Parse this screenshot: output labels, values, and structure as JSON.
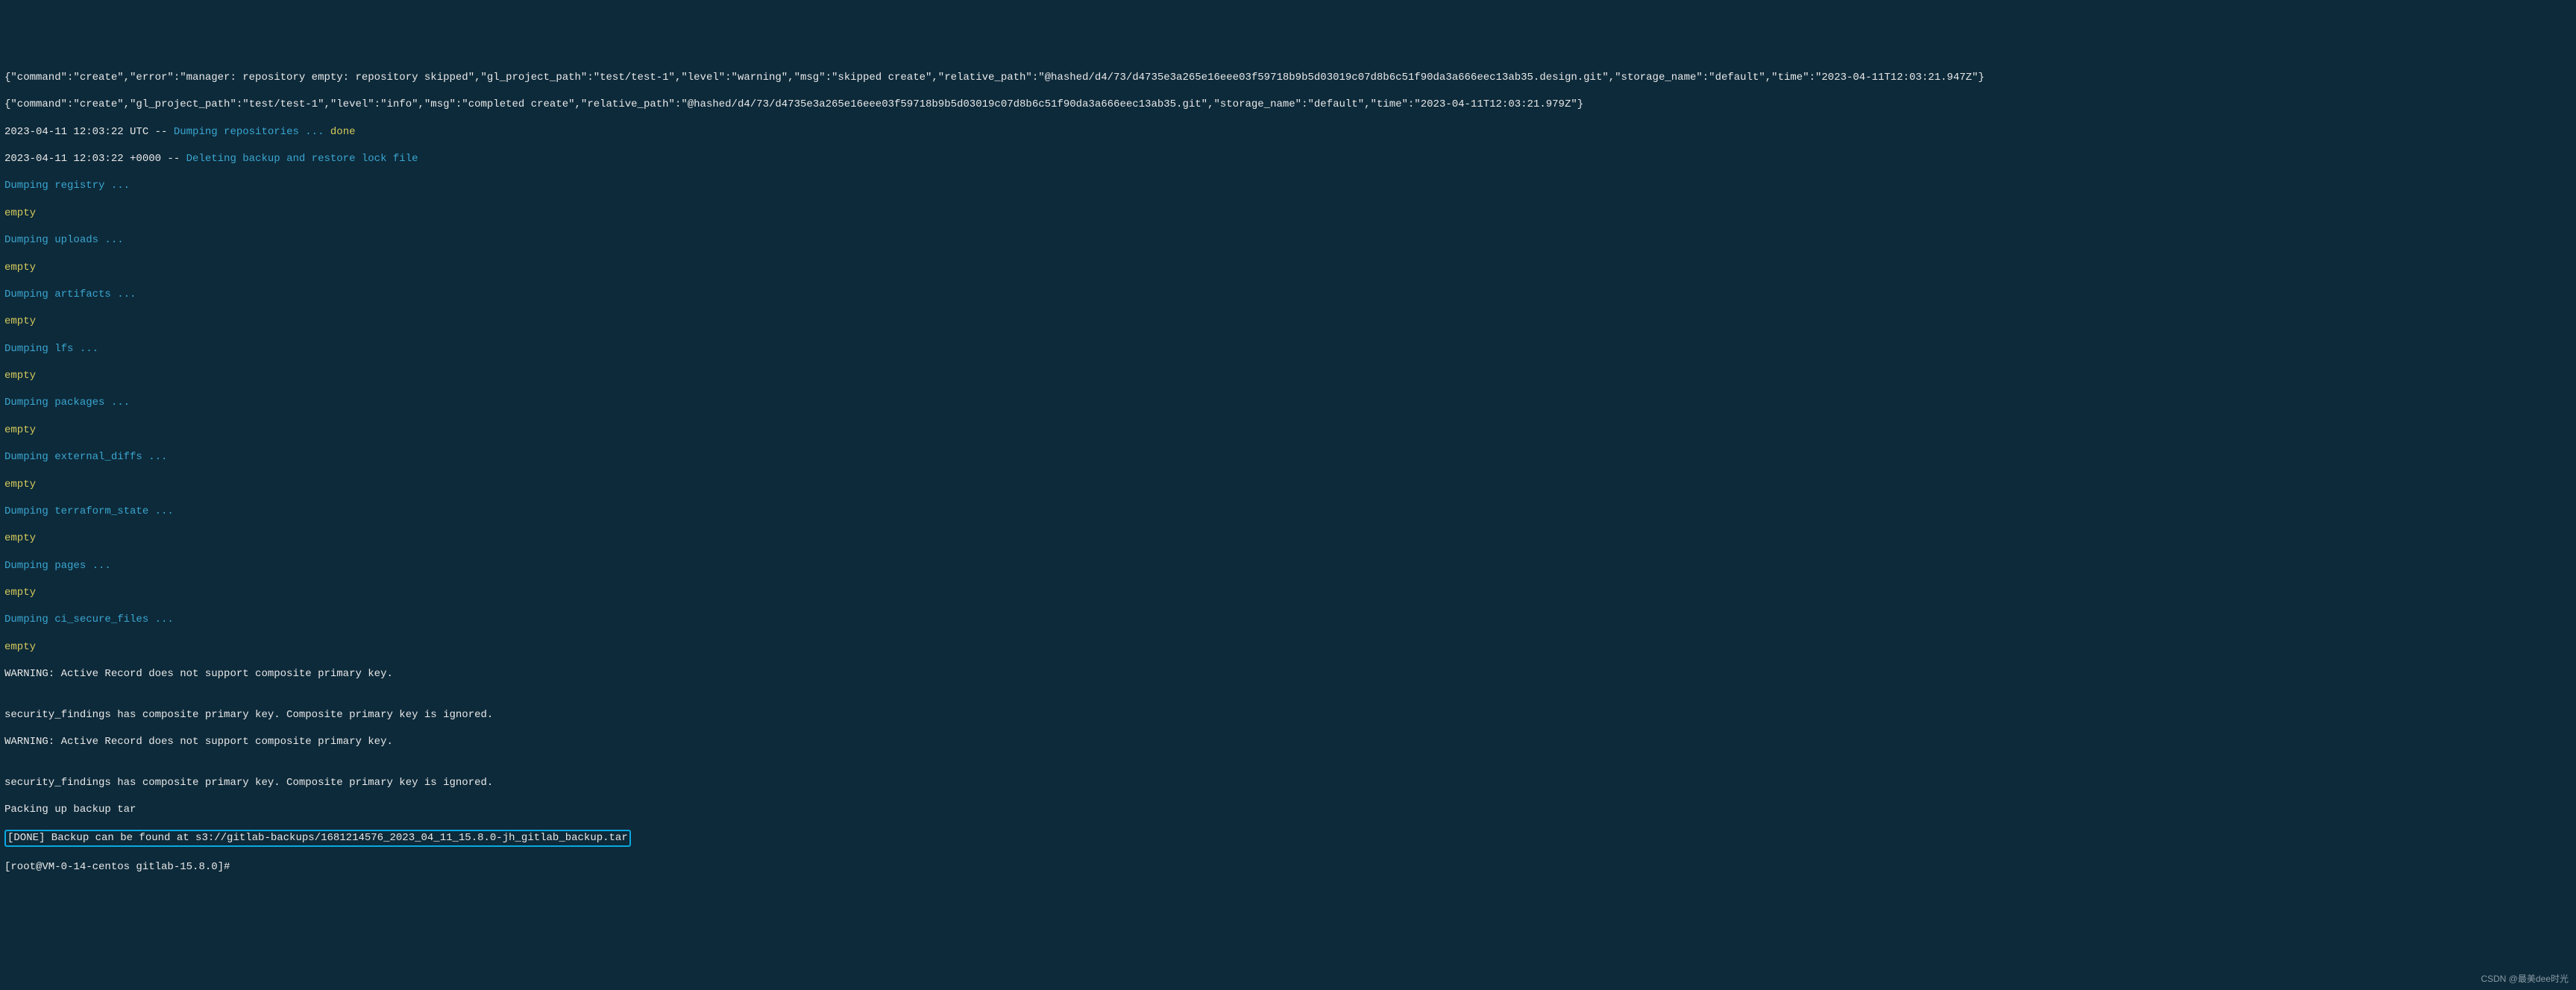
{
  "json_line1": "{\"command\":\"create\",\"error\":\"manager: repository empty: repository skipped\",\"gl_project_path\":\"test/test-1\",\"level\":\"warning\",\"msg\":\"skipped create\",\"relative_path\":\"@hashed/d4/73/d4735e3a265e16eee03f59718b9b5d03019c07d8b6c51f90da3a666eec13ab35.design.git\",\"storage_name\":\"default\",\"time\":\"2023-04-11T12:03:21.947Z\"}",
  "json_line2": "{\"command\":\"create\",\"gl_project_path\":\"test/test-1\",\"level\":\"info\",\"msg\":\"completed create\",\"relative_path\":\"@hashed/d4/73/d4735e3a265e16eee03f59718b9b5d03019c07d8b6c51f90da3a666eec13ab35.git\",\"storage_name\":\"default\",\"time\":\"2023-04-11T12:03:21.979Z\"}",
  "ts1_prefix": "2023-04-11 12:03:22 UTC -- ",
  "ts1_msg": "Dumping repositories ... ",
  "ts1_done": "done",
  "ts2_prefix": "2023-04-11 12:03:22 +0000 -- ",
  "ts2_msg": "Deleting backup and restore lock file",
  "dump_registry": "Dumping registry ...",
  "dump_uploads": "Dumping uploads ...",
  "dump_artifacts": "Dumping artifacts ...",
  "dump_lfs": "Dumping lfs ...",
  "dump_packages": "Dumping packages ...",
  "dump_external_diffs": "Dumping external_diffs ...",
  "dump_terraform_state": "Dumping terraform_state ...",
  "dump_pages": "Dumping pages ...",
  "dump_ci_secure_files": "Dumping ci_secure_files ...",
  "empty": "empty",
  "warn1": "WARNING: Active Record does not support composite primary key.",
  "blank": "",
  "sec_findings": "security_findings has composite primary key. Composite primary key is ignored.",
  "packing": "Packing up backup tar",
  "done_backup": "[DONE] Backup can be found at s3://gitlab-backups/1681214576_2023_04_11_15.8.0-jh_gitlab_backup.tar",
  "prompt": "[root@VM-0-14-centos gitlab-15.8.0]#",
  "watermark": "CSDN @最美dee时光"
}
